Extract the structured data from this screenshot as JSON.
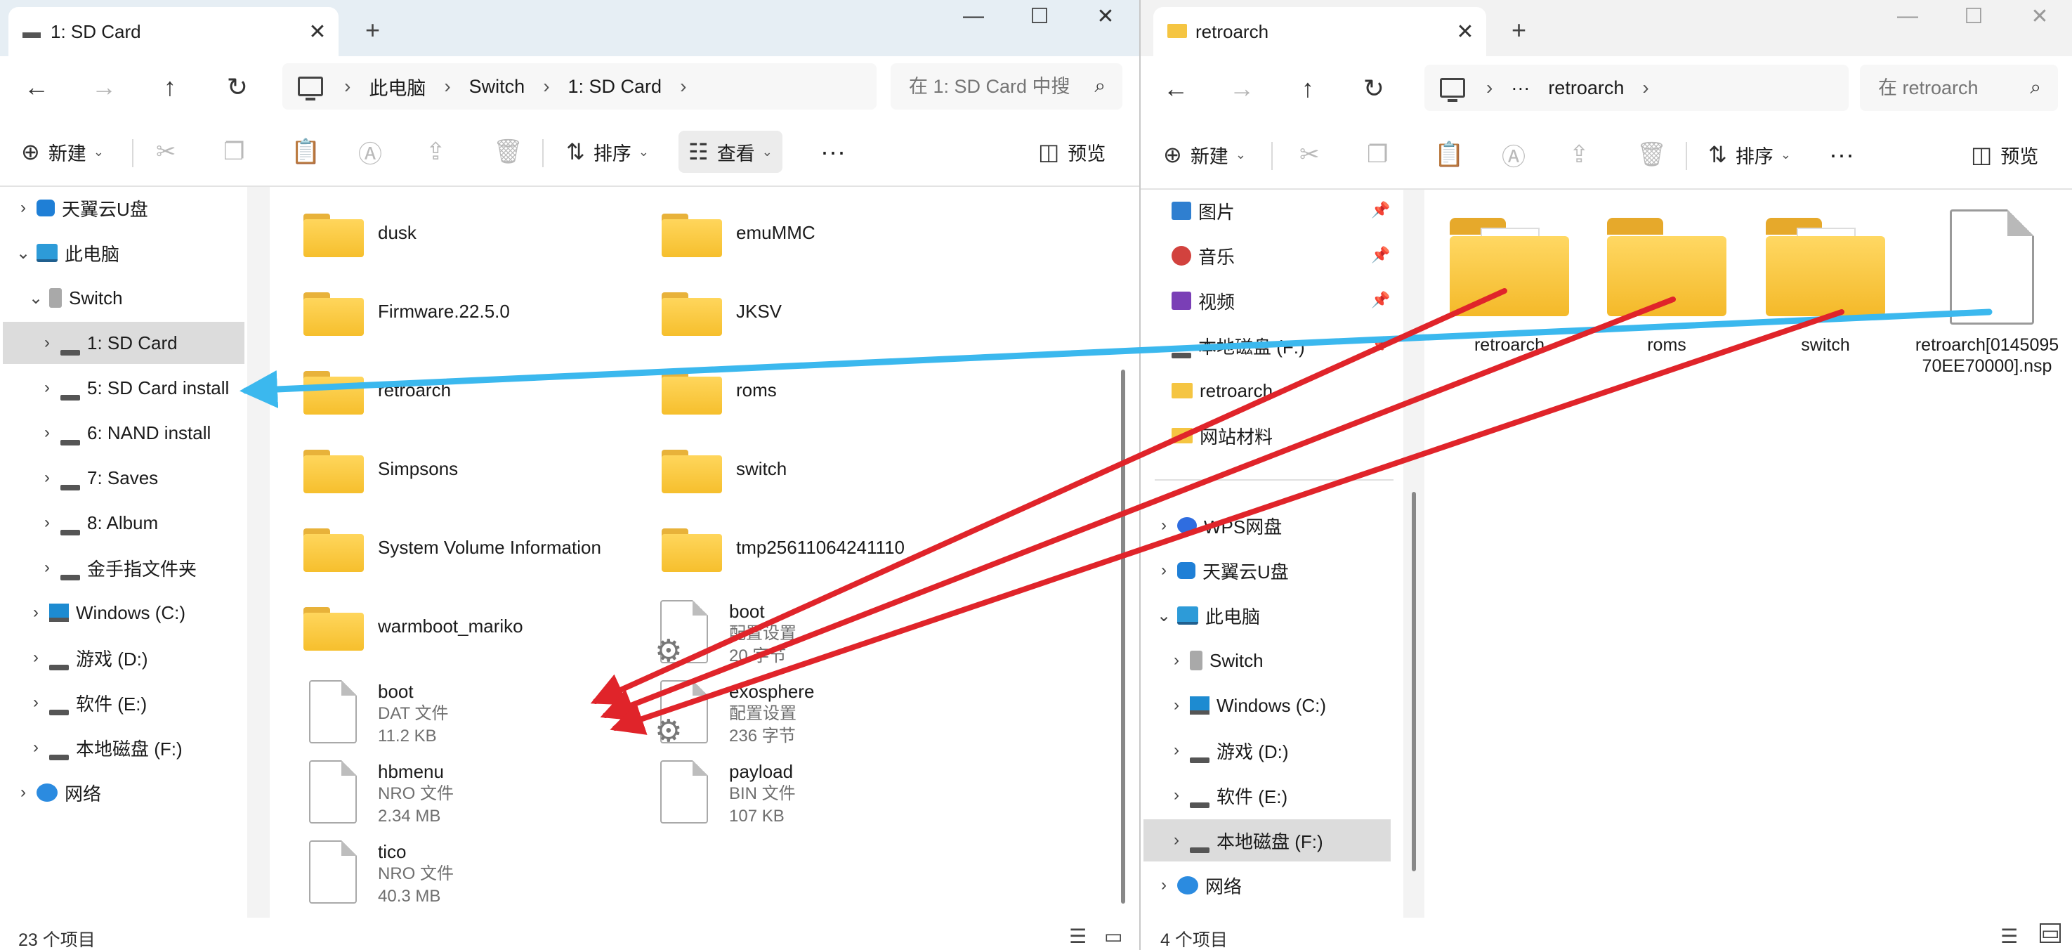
{
  "left_window": {
    "tab_title": "1: SD Card",
    "path": [
      "此电脑",
      "Switch",
      "1: SD Card"
    ],
    "search_placeholder": "在 1: SD Card 中搜",
    "toolbar": {
      "new_label": "新建",
      "sort_label": "排序",
      "view_label": "查看",
      "preview_label": "预览"
    },
    "nav": [
      {
        "label": "天翼云U盘",
        "icon": "cloud-icon"
      },
      {
        "label": "此电脑",
        "icon": "pc-icon"
      },
      {
        "label": "Switch",
        "icon": "sdcard-icon"
      },
      {
        "label": "1: SD Card",
        "icon": "drive-icon"
      },
      {
        "label": "5: SD Card install",
        "icon": "drive-icon"
      },
      {
        "label": "6: NAND install",
        "icon": "drive-icon"
      },
      {
        "label": "7: Saves",
        "icon": "drive-icon"
      },
      {
        "label": "8: Album",
        "icon": "drive-icon"
      },
      {
        "label": "金手指文件夹",
        "icon": "drive-icon"
      },
      {
        "label": "Windows (C:)",
        "icon": "windows-drive-icon"
      },
      {
        "label": "游戏 (D:)",
        "icon": "drive-icon"
      },
      {
        "label": "软件 (E:)",
        "icon": "drive-icon"
      },
      {
        "label": "本地磁盘 (F:)",
        "icon": "drive-icon"
      },
      {
        "label": "网络",
        "icon": "network-icon"
      }
    ],
    "folders": [
      "dusk",
      "emuMMC",
      "Firmware.22.5.0",
      "JKSV",
      "retroarch",
      "roms",
      "Simpsons",
      "switch",
      "System Volume Information",
      "tmp25611064241110",
      "warmboot_mariko"
    ],
    "files": [
      {
        "name": "boot",
        "type": "配置设置",
        "size": "20 字节",
        "gear": true
      },
      {
        "name": "boot",
        "type": "DAT 文件",
        "size": "11.2 KB",
        "gear": false
      },
      {
        "name": "exosphere",
        "type": "配置设置",
        "size": "236 字节",
        "gear": true
      },
      {
        "name": "hbmenu",
        "type": "NRO 文件",
        "size": "2.34 MB",
        "gear": false
      },
      {
        "name": "payload",
        "type": "BIN 文件",
        "size": "107 KB",
        "gear": false
      },
      {
        "name": "tico",
        "type": "NRO 文件",
        "size": "40.3 MB",
        "gear": false
      }
    ],
    "status": "23 个项目"
  },
  "right_window": {
    "tab_title": "retroarch",
    "path_ellipsis": "···",
    "path": [
      "retroarch"
    ],
    "search_placeholder": "在 retroarch",
    "toolbar": {
      "new_label": "新建",
      "sort_label": "排序",
      "preview_label": "预览"
    },
    "nav": [
      {
        "label": "图片",
        "icon": "pictures-icon",
        "pinned": true
      },
      {
        "label": "音乐",
        "icon": "music-icon",
        "pinned": true
      },
      {
        "label": "视频",
        "icon": "video-icon",
        "pinned": true
      },
      {
        "label": "本地磁盘 (F:)",
        "icon": "drive-icon",
        "pinned": true
      },
      {
        "label": "retroarch",
        "icon": "folder-icon"
      },
      {
        "label": "网站材料",
        "icon": "folder-icon"
      },
      {
        "label": "WPS网盘",
        "icon": "wps-icon"
      },
      {
        "label": "天翼云U盘",
        "icon": "cloud-icon"
      },
      {
        "label": "此电脑",
        "icon": "pc-icon"
      },
      {
        "label": "Switch",
        "icon": "sdcard-icon"
      },
      {
        "label": "Windows (C:)",
        "icon": "windows-drive-icon"
      },
      {
        "label": "游戏 (D:)",
        "icon": "drive-icon"
      },
      {
        "label": "软件 (E:)",
        "icon": "drive-icon"
      },
      {
        "label": "本地磁盘 (F:)",
        "icon": "drive-icon"
      },
      {
        "label": "网络",
        "icon": "network-icon"
      }
    ],
    "items": [
      {
        "name": "retroarch",
        "kind": "folder"
      },
      {
        "name": "roms",
        "kind": "folder"
      },
      {
        "name": "switch",
        "kind": "folder"
      },
      {
        "name": "retroarch[014509570EE70000].nsp",
        "kind": "file"
      }
    ],
    "status": "4 个项目"
  },
  "colors": {
    "arrow_blue": "#3bb8ee",
    "arrow_red": "#e0242a",
    "selection": "#dcdcdc",
    "accent": "#0a64c8"
  }
}
